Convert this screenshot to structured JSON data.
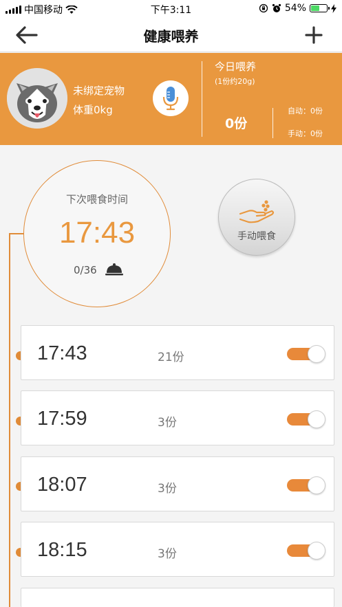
{
  "status_bar": {
    "carrier": "中国移动",
    "time": "下午3:11",
    "battery": "54%",
    "battery_level": 0.54
  },
  "nav": {
    "title": "健康喂养",
    "back_icon": "arrow-left-icon",
    "add_icon": "plus-icon"
  },
  "pet": {
    "name": "未绑定宠物",
    "weight": "体重0kg",
    "avatar_icon": "husky-dog-icon",
    "voice_icon": "microphone-icon"
  },
  "today": {
    "title": "今日喂养",
    "note": "(1份约20g)",
    "total": "0份",
    "auto": "自动：0份",
    "manual": "手动：0份"
  },
  "next_feed": {
    "label": "下次喂食时间",
    "time": "17:43",
    "count": "0/36",
    "icon": "food-cloche-icon"
  },
  "manual_feed": {
    "label": "手动喂食",
    "icon": "hand-feed-icon"
  },
  "schedules": [
    {
      "time": "17:43",
      "portions": "21份",
      "enabled": true
    },
    {
      "time": "17:59",
      "portions": "3份",
      "enabled": true
    },
    {
      "time": "18:07",
      "portions": "3份",
      "enabled": true
    },
    {
      "time": "18:15",
      "portions": "3份",
      "enabled": true
    }
  ],
  "colors": {
    "accent": "#e9983f",
    "toggle_on": "#e8893a",
    "timeline": "#e08b38"
  }
}
